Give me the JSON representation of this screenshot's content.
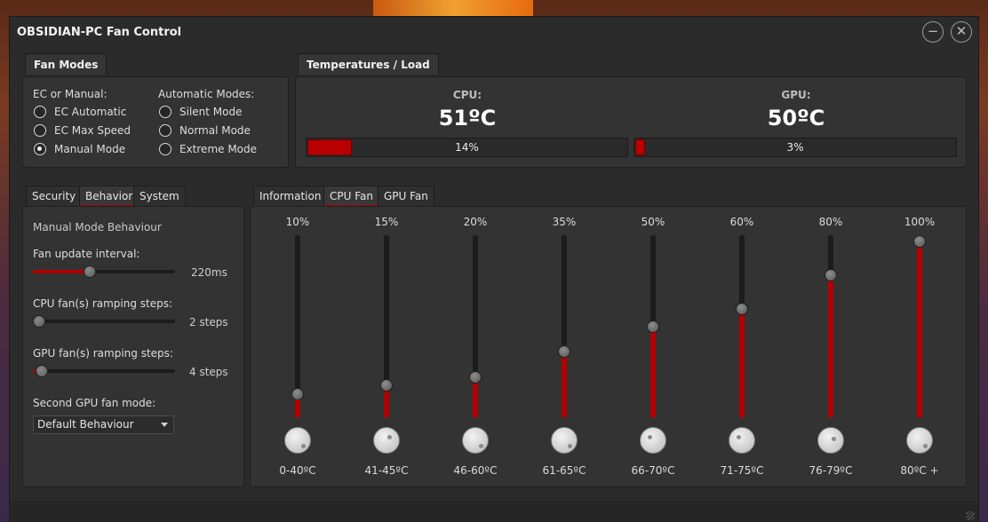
{
  "window": {
    "title": "OBSIDIAN-PC Fan Control",
    "minimize_glyph": "−",
    "close_glyph": "✕"
  },
  "fan_modes": {
    "tab": "Fan Modes",
    "ec_heading": "EC or Manual:",
    "ec_options": [
      {
        "label": "EC Automatic",
        "selected": false
      },
      {
        "label": "EC Max Speed",
        "selected": false
      },
      {
        "label": "Manual Mode",
        "selected": true
      }
    ],
    "auto_heading": "Automatic Modes:",
    "auto_options": [
      {
        "label": "Silent Mode",
        "selected": false
      },
      {
        "label": "Normal Mode",
        "selected": false
      },
      {
        "label": "Extreme Mode",
        "selected": false
      }
    ]
  },
  "temps": {
    "tab": "Temperatures / Load",
    "cpu": {
      "label": "CPU:",
      "temp": "51ºC",
      "load_text": "14%",
      "load": 0.14
    },
    "gpu": {
      "label": "GPU:",
      "temp": "50ºC",
      "load_text": "3%",
      "load": 0.03
    }
  },
  "left_tabs": [
    "Security",
    "Behavior",
    "System"
  ],
  "behavior": {
    "heading": "Manual Mode Behaviour",
    "update_interval": {
      "label": "Fan update interval:",
      "value_text": "220ms",
      "fraction": 0.39
    },
    "cpu_steps": {
      "label": "CPU fan(s) ramping steps:",
      "value_text": "2 steps",
      "fraction": 0.0
    },
    "gpu_steps": {
      "label": "GPU fan(s) ramping steps:",
      "value_text": "4 steps",
      "fraction": 0.02
    },
    "gpu_mode": {
      "label": "Second GPU fan mode:",
      "selected": "Default Behaviour"
    }
  },
  "right_tabs": [
    "Information",
    "CPU Fan",
    "GPU Fan"
  ],
  "cpu_fan_curve": [
    {
      "percent_text": "10%",
      "percent": 10,
      "range": "0-40ºC"
    },
    {
      "percent_text": "15%",
      "percent": 15,
      "range": "41-45ºC"
    },
    {
      "percent_text": "20%",
      "percent": 20,
      "range": "46-60ºC"
    },
    {
      "percent_text": "35%",
      "percent": 35,
      "range": "61-65ºC"
    },
    {
      "percent_text": "50%",
      "percent": 50,
      "range": "66-70ºC"
    },
    {
      "percent_text": "60%",
      "percent": 60,
      "range": "71-75ºC"
    },
    {
      "percent_text": "80%",
      "percent": 80,
      "range": "76-79ºC"
    },
    {
      "percent_text": "100%",
      "percent": 100,
      "range": "80ºC +"
    }
  ],
  "colors": {
    "accent": "#b30000",
    "background": "#2b2b2b",
    "panel": "#333333"
  }
}
